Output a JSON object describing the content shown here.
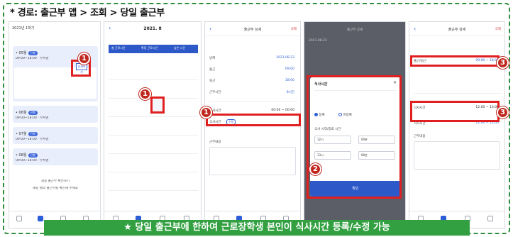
{
  "breadcrumb": "* 경로: 출근부 앱 > 조회 > 당일 출근부",
  "banner": "★ 당일 출근부에 한하여 근로장학생 본인이 식사시간 등록/수정 가능",
  "colors": {
    "frame_border": "#2f8f3a",
    "banner_bg": "#32a041",
    "highlight": "#e02020",
    "marker": "#c0281e",
    "app_blue": "#2c58c8"
  },
  "phone1": {
    "header": "2021년 1학기",
    "cards": [
      {
        "title": "• 05월",
        "tag": "진행",
        "sub": "09:00~18:00 · 부서명"
      },
      {
        "title": "• 06월",
        "tag": "진행",
        "sub": "09:00~18:00 · 부서명"
      },
      {
        "title": "• 07월",
        "tag": "진행",
        "sub": "09:00~18:00 · 부서명"
      },
      {
        "title": "• 08월",
        "tag": "진행",
        "sub": "09:00~18:00 · 부서명"
      }
    ],
    "view_button": "상세보기",
    "notice_1": "최종 출근부 확인하기",
    "notice_2": "해당 월의 출근부를 확인해 주세요"
  },
  "phone2": {
    "title": "2021. 8",
    "header_cells": [
      "총 근로시간",
      "확정 근로시간",
      "남은 시간"
    ]
  },
  "phone3": {
    "title": "출근부 상세",
    "right": "삭제",
    "fields": [
      {
        "label": "날짜",
        "value": "2021.08.23"
      },
      {
        "label": "출근",
        "value": "09:00"
      },
      {
        "label": "퇴근",
        "value": "18:00"
      },
      {
        "label": "근무시간",
        "value": "8시간"
      }
    ],
    "meal_label": "식사시간",
    "meal_pill": "수정",
    "meal_value": "00:00 ~ 00:00",
    "memo_label": "근무내용"
  },
  "phone4": {
    "modal_title": "식사시간",
    "radio_on": "등록",
    "radio_off": "미등록",
    "time_label": "식사 시작/종료 시간",
    "start_hour": "12시",
    "start_min": "00분",
    "end_hour": "13시",
    "end_min": "00분",
    "submit": "확인"
  },
  "phone5": {
    "title": "출근부 상세",
    "right": "삭제",
    "row_label": "출근/퇴근",
    "row_value": "09:00 ~ 18:00",
    "meal_label": "식사시간",
    "meal_value": "12:00 ~ 13:00",
    "memo_label": "근무내용"
  },
  "markers": [
    "1",
    "1",
    "1",
    "2",
    "3",
    "3"
  ]
}
